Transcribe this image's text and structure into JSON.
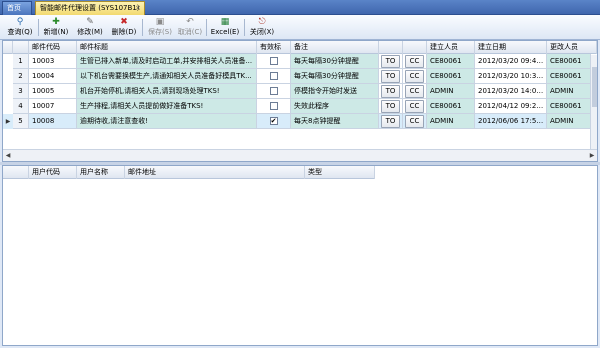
{
  "tabs": {
    "home_label": "首页",
    "active_label": "智能邮件代理设置 (SYS107B1)",
    "close_glyph": "×"
  },
  "toolbar": {
    "query": "查询(Q)",
    "add": "新增(N)",
    "edit": "修改(M)",
    "delete": "删除(D)",
    "save": "保存(S)",
    "cancel": "取消(C)",
    "excel": "Excel(E)",
    "close": "关闭(X)",
    "icons": {
      "query": "search-icon",
      "add": "add-icon",
      "edit": "edit-icon",
      "delete": "delete-icon",
      "save": "save-icon",
      "cancel": "undo-icon",
      "excel": "excel-icon",
      "close": "exit-icon"
    }
  },
  "grid": {
    "headers": {
      "code": "邮件代码",
      "title": "邮件标题",
      "valid": "有效标",
      "note": "备注",
      "creator": "建立人员",
      "created_date": "建立日期",
      "modifier": "更改人员"
    },
    "row_indicator_glyph": "▶",
    "rows": [
      {
        "num": "1",
        "code": "10003",
        "title": "生管已排入新单,请及时启动工单,并安排相关人员准备...",
        "checked": false,
        "note": "每天每隔30分钟提醒",
        "to": "TO",
        "cc": "CC",
        "creator": "CE80061",
        "date": "2012/03/20 09:42...",
        "modifier": "CE80061"
      },
      {
        "num": "2",
        "code": "10004",
        "title": "以下机台需要换模生产,请通知相关人员准备好模具TK...",
        "checked": false,
        "note": "每天每隔30分钟提醒",
        "to": "TO",
        "cc": "CC",
        "creator": "CE80061",
        "date": "2012/03/20 10:31...",
        "modifier": "CE80061"
      },
      {
        "num": "3",
        "code": "10005",
        "title": "机台开始停机,请相关人员,请到现场处理TKS!",
        "checked": false,
        "note": "停模指令开始时发送",
        "to": "TO",
        "cc": "CC",
        "creator": "ADMIN",
        "date": "2012/03/20 14:00...",
        "modifier": "ADMIN"
      },
      {
        "num": "4",
        "code": "10007",
        "title": "生产排程,请相关人员提前做好准备TKS!",
        "checked": false,
        "note": "失效此程序",
        "to": "TO",
        "cc": "CC",
        "creator": "CE80061",
        "date": "2012/04/12 09:26...",
        "modifier": "CE80061"
      },
      {
        "num": "5",
        "code": "10008",
        "title": "逾期待收,请注意查收!",
        "checked": true,
        "note": "每天8点钟提醒",
        "to": "TO",
        "cc": "CC",
        "creator": "ADMIN",
        "date": "2012/06/06 17:50...",
        "modifier": "ADMIN"
      }
    ]
  },
  "grid2": {
    "headers": {
      "user_code": "用户代码",
      "user_name": "用户名称",
      "email": "邮件地址",
      "type": "类型"
    }
  }
}
